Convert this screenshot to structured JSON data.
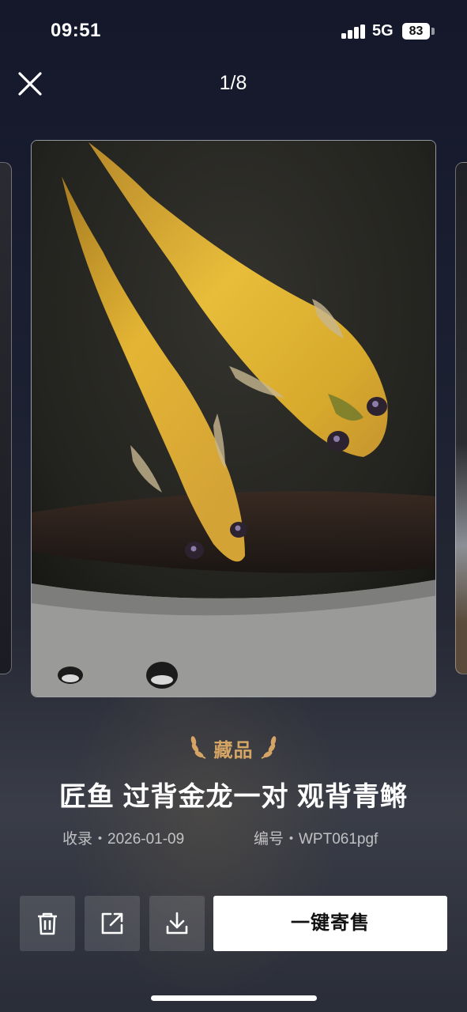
{
  "status_bar": {
    "time": "09:51",
    "network": "5G",
    "battery": "83"
  },
  "header": {
    "counter": "1/8"
  },
  "item": {
    "badge": "藏品",
    "title": "匠鱼 过背金龙一对 观背青鳉",
    "collected_label": "收录・2026-01-09",
    "serial_label": "编号・WPT061pgf"
  },
  "actions": {
    "delete_icon": "trash-icon",
    "share_icon": "external-link-icon",
    "download_icon": "download-icon",
    "consign_label": "一键寄售"
  },
  "colors": {
    "badge": "#d5a565",
    "primary_button_bg": "#ffffff"
  }
}
